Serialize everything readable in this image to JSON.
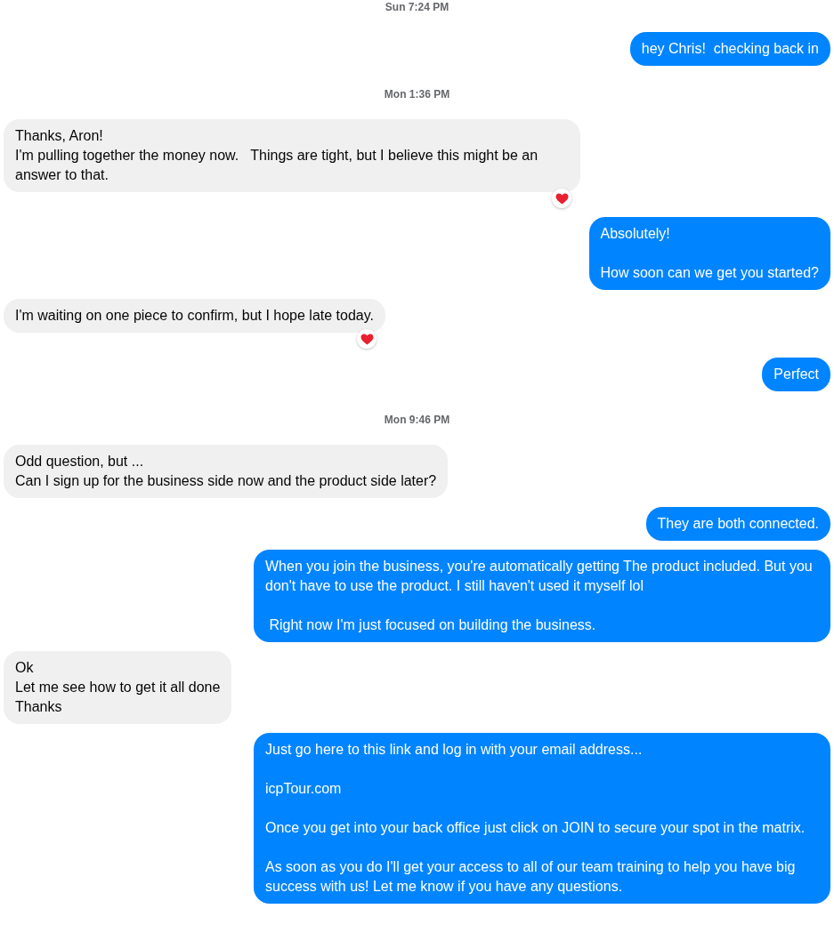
{
  "conversation": [
    {
      "kind": "timestamp",
      "text": "Sun 7:24 PM"
    },
    {
      "kind": "message",
      "outgoing": true,
      "text": "hey Chris!  checking back in",
      "reacted": false
    },
    {
      "kind": "timestamp",
      "text": "Mon 1:36 PM"
    },
    {
      "kind": "message",
      "outgoing": false,
      "text": "Thanks, Aron!\nI'm pulling together the money now.   Things are tight, but I believe this might be an answer to that.",
      "reacted": true
    },
    {
      "kind": "message",
      "outgoing": true,
      "text": "Absolutely!\n\nHow soon can we get you started?",
      "reacted": false
    },
    {
      "kind": "message",
      "outgoing": false,
      "text": "I'm waiting on one piece to confirm, but I hope late today.",
      "reacted": true
    },
    {
      "kind": "message",
      "outgoing": true,
      "text": "Perfect",
      "reacted": false
    },
    {
      "kind": "timestamp",
      "text": "Mon 9:46 PM"
    },
    {
      "kind": "message",
      "outgoing": false,
      "text": "Odd question, but ...\nCan I sign up for the business side now and the product side later?",
      "reacted": false
    },
    {
      "kind": "message",
      "outgoing": true,
      "text": "They are both connected.",
      "reacted": false
    },
    {
      "kind": "message",
      "outgoing": true,
      "text": "When you join the business, you're automatically getting The product included. But you don't have to use the product. I still haven't used it myself lol\n\n Right now I'm just focused on building the business.",
      "reacted": false
    },
    {
      "kind": "message",
      "outgoing": false,
      "text": "Ok\nLet me see how to get it all done\nThanks",
      "reacted": false
    },
    {
      "kind": "message",
      "outgoing": true,
      "text": "Just go here to this link and log in with your email address...\n\nicpTour.com\n\nOnce you get into your back office just click on JOIN to secure your spot in the matrix.\n\nAs soon as you do I'll get your access to all of our team training to help you have big success with us! Let me know if you have any questions.",
      "reacted": false
    }
  ]
}
